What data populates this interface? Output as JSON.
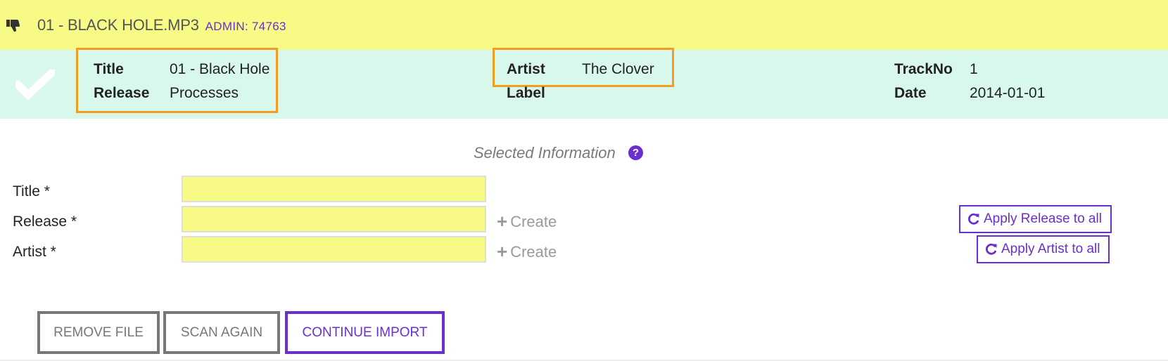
{
  "header": {
    "filename": "01 - BLACK HOLE.MP3",
    "admin": "ADMIN: 74763",
    "icon": "thumbs-down-icon"
  },
  "info": {
    "status_icon": "check-icon",
    "title_label": "Title",
    "title_value": "01 - Black Hole",
    "release_label": "Release",
    "release_value": "Processes",
    "artist_label": "Artist",
    "artist_value": "The Clover",
    "label_label": "Label",
    "label_value": "",
    "trackno_label": "TrackNo",
    "trackno_value": "1",
    "date_label": "Date",
    "date_value": "2014-01-01"
  },
  "selected": {
    "heading": "Selected Information",
    "help_glyph": "?",
    "fields": [
      {
        "label": "Title *",
        "value": ""
      },
      {
        "label": "Release *",
        "value": ""
      },
      {
        "label": "Artist *",
        "value": ""
      }
    ],
    "create_label": "Create",
    "apply_release_label": "Apply Release to all",
    "apply_artist_label": "Apply Artist to all"
  },
  "actions": {
    "remove_label": "REMOVE FILE",
    "scan_label": "SCAN AGAIN",
    "continue_label": "CONTINUE IMPORT"
  },
  "colors": {
    "header_bg": "#f7fb86",
    "info_bg": "#d9f8ec",
    "accent": "#6b2ed1",
    "highlight": "#f39c1f",
    "input_bg": "#f7fb86"
  }
}
